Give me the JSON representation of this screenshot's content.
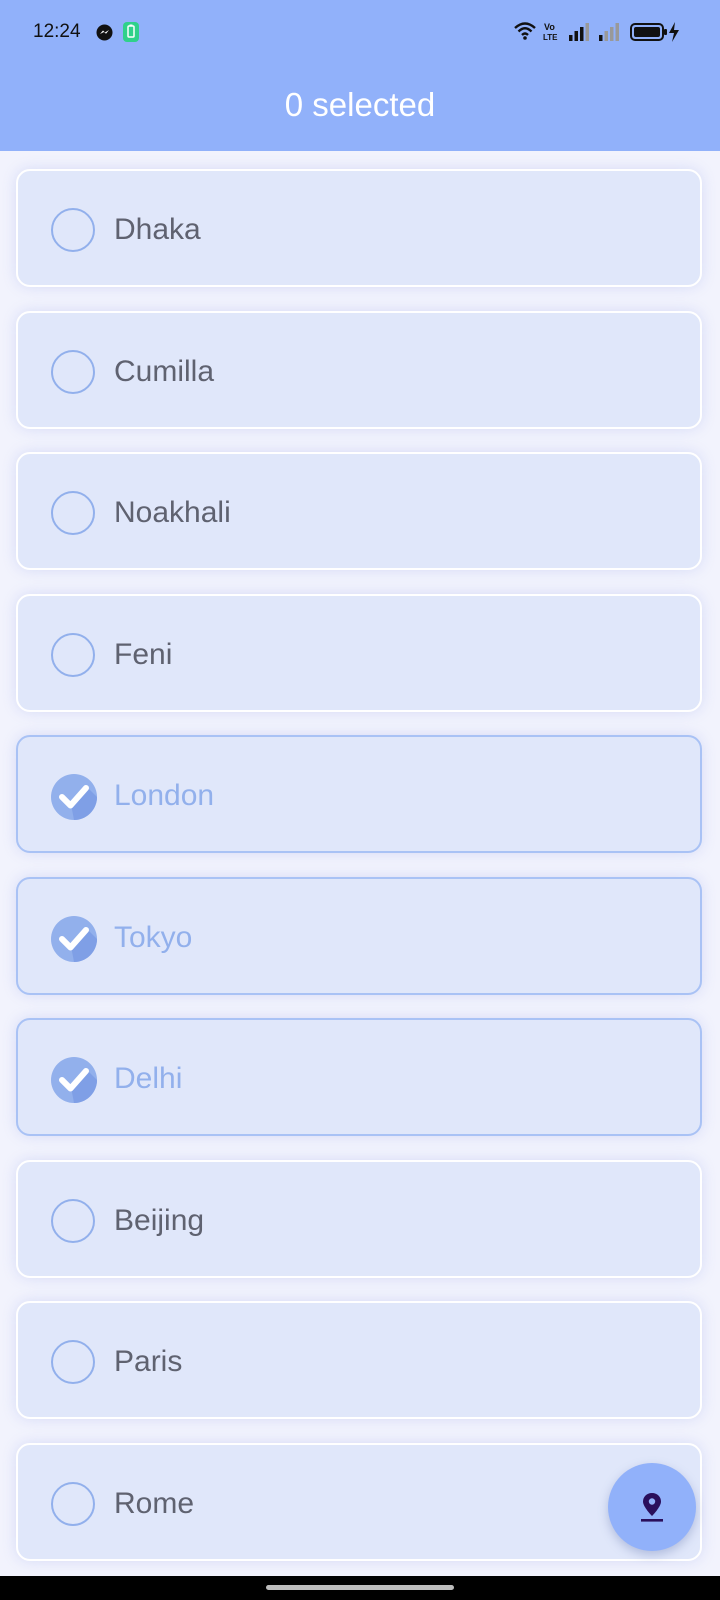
{
  "status": {
    "time": "12:24"
  },
  "appbar": {
    "title": "0 selected"
  },
  "cities": [
    {
      "name": "Dhaka",
      "selected": false
    },
    {
      "name": "Cumilla",
      "selected": false
    },
    {
      "name": "Noakhali",
      "selected": false
    },
    {
      "name": "Feni",
      "selected": false
    },
    {
      "name": "London",
      "selected": true
    },
    {
      "name": "Tokyo",
      "selected": true
    },
    {
      "name": "Delhi",
      "selected": true
    },
    {
      "name": "Beijing",
      "selected": false
    },
    {
      "name": "Paris",
      "selected": false
    },
    {
      "name": "Rome",
      "selected": false
    }
  ],
  "fab": {
    "icon": "location-pin-icon"
  },
  "colors": {
    "appbar": "#91b1fa",
    "card": "#e0e7fa",
    "accent": "#92b0ec",
    "text": "#5f6270"
  }
}
